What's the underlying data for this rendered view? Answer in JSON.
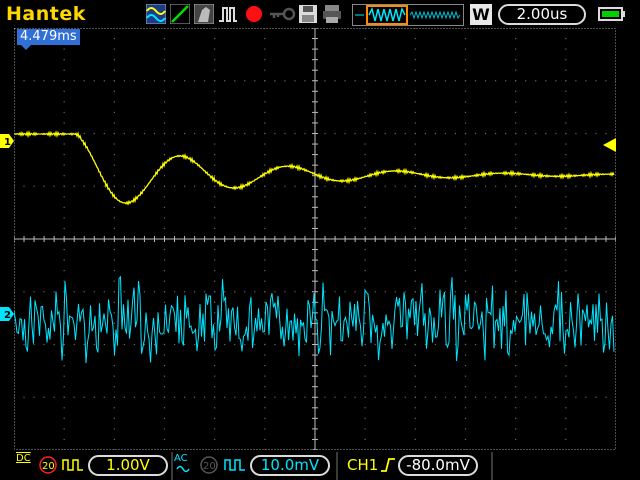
{
  "brand": "Hantek",
  "toolbar": {
    "icons": [
      "waveform-type-icon",
      "slope-icon",
      "probe-icon",
      "pulse-icon",
      "record-icon",
      "key-icon",
      "save-disk-icon",
      "print-icon"
    ],
    "wave_mode": "W",
    "timebase": "2.00us"
  },
  "trigger_time_marker": "4.479ms",
  "channels": {
    "ch1": {
      "marker": "1",
      "color": "#ffff00",
      "coupling": "DC",
      "bw_limit": "20",
      "volts_div": "1.00V"
    },
    "ch2": {
      "marker": "2",
      "color": "#00e5ff",
      "coupling": "AC",
      "bw_limit": "20",
      "volts_div": "10.0mV"
    }
  },
  "trigger": {
    "source": "CH1",
    "slope": "rising",
    "level": "-80.0mV"
  },
  "colors": {
    "brand": "#ffd700",
    "grid": "#7a7a7a",
    "ch1": "#ffff00",
    "ch2": "#00e5ff",
    "accent_blue": "#2f6fd6"
  }
}
